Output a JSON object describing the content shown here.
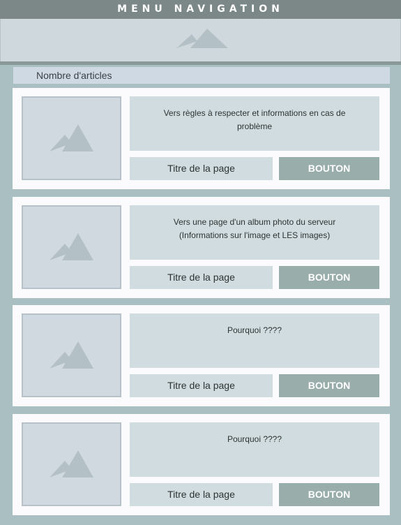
{
  "header": {
    "title": "MENU NAVIGATION",
    "banner_icon": "image-placeholder-icon"
  },
  "count_label": "Nombre d'articles",
  "articles": [
    {
      "thumb_icon": "image-placeholder-icon",
      "description": "Vers règles à respecter et informations en cas de\nproblème",
      "title": "Titre de la page",
      "button_label": "BOUTON"
    },
    {
      "thumb_icon": "image-placeholder-icon",
      "description": "Vers une page d'un album photo du serveur\n(Informations sur l'image et LES images)",
      "title": "Titre de la page",
      "button_label": "BOUTON"
    },
    {
      "thumb_icon": "image-placeholder-icon",
      "description": "Pourquoi ????",
      "title": "Titre de la page",
      "button_label": "BOUTON"
    },
    {
      "thumb_icon": "image-placeholder-icon",
      "description": "Pourquoi ????",
      "title": "Titre de la page",
      "button_label": "BOUTON"
    }
  ],
  "colors": {
    "topbar": "#7c8787",
    "panel_bg": "#aabfc1",
    "card_bg": "#fbfbfe",
    "cell_bg": "#d0dcdf",
    "button_bg": "#99adab",
    "icon": "#b3c0c5"
  }
}
